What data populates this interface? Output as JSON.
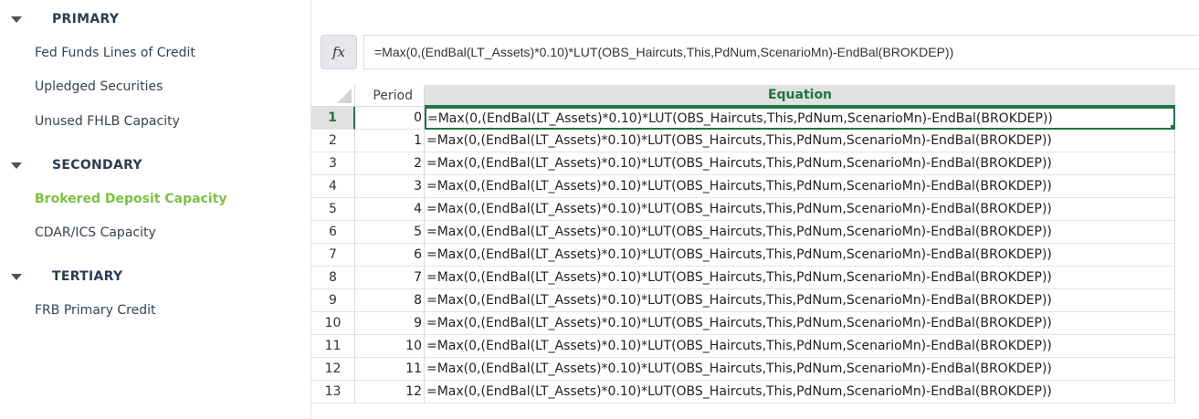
{
  "sidebar": {
    "sections": [
      {
        "title": "PRIMARY",
        "items": [
          "Fed Funds Lines of Credit",
          "Upledged Securities",
          "Unused FHLB Capacity"
        ]
      },
      {
        "title": "SECONDARY",
        "items": [
          "Brokered Deposit Capacity",
          "CDAR/ICS Capacity"
        ]
      },
      {
        "title": "TERTIARY",
        "items": [
          "FRB Primary Credit"
        ]
      }
    ],
    "active_item": "Brokered Deposit Capacity"
  },
  "formula_bar": {
    "fx_label": "fx",
    "value": "=Max(0,(EndBal(LT_Assets)*0.10)*LUT(OBS_Haircuts,This,PdNum,ScenarioMn)-EndBal(BROKDEP))"
  },
  "grid": {
    "headers": {
      "period": "Period",
      "equation": "Equation"
    },
    "rows": [
      {
        "num": "1",
        "period": "0",
        "equation": "=Max(0,(EndBal(LT_Assets)*0.10)*LUT(OBS_Haircuts,This,PdNum,ScenarioMn)-EndBal(BROKDEP))"
      },
      {
        "num": "2",
        "period": "1",
        "equation": "=Max(0,(EndBal(LT_Assets)*0.10)*LUT(OBS_Haircuts,This,PdNum,ScenarioMn)-EndBal(BROKDEP))"
      },
      {
        "num": "3",
        "period": "2",
        "equation": "=Max(0,(EndBal(LT_Assets)*0.10)*LUT(OBS_Haircuts,This,PdNum,ScenarioMn)-EndBal(BROKDEP))"
      },
      {
        "num": "4",
        "period": "3",
        "equation": "=Max(0,(EndBal(LT_Assets)*0.10)*LUT(OBS_Haircuts,This,PdNum,ScenarioMn)-EndBal(BROKDEP))"
      },
      {
        "num": "5",
        "period": "4",
        "equation": "=Max(0,(EndBal(LT_Assets)*0.10)*LUT(OBS_Haircuts,This,PdNum,ScenarioMn)-EndBal(BROKDEP))"
      },
      {
        "num": "6",
        "period": "5",
        "equation": "=Max(0,(EndBal(LT_Assets)*0.10)*LUT(OBS_Haircuts,This,PdNum,ScenarioMn)-EndBal(BROKDEP))"
      },
      {
        "num": "7",
        "period": "6",
        "equation": "=Max(0,(EndBal(LT_Assets)*0.10)*LUT(OBS_Haircuts,This,PdNum,ScenarioMn)-EndBal(BROKDEP))"
      },
      {
        "num": "8",
        "period": "7",
        "equation": "=Max(0,(EndBal(LT_Assets)*0.10)*LUT(OBS_Haircuts,This,PdNum,ScenarioMn)-EndBal(BROKDEP))"
      },
      {
        "num": "9",
        "period": "8",
        "equation": "=Max(0,(EndBal(LT_Assets)*0.10)*LUT(OBS_Haircuts,This,PdNum,ScenarioMn)-EndBal(BROKDEP))"
      },
      {
        "num": "10",
        "period": "9",
        "equation": "=Max(0,(EndBal(LT_Assets)*0.10)*LUT(OBS_Haircuts,This,PdNum,ScenarioMn)-EndBal(BROKDEP))"
      },
      {
        "num": "11",
        "period": "10",
        "equation": "=Max(0,(EndBal(LT_Assets)*0.10)*LUT(OBS_Haircuts,This,PdNum,ScenarioMn)-EndBal(BROKDEP))"
      },
      {
        "num": "12",
        "period": "11",
        "equation": "=Max(0,(EndBal(LT_Assets)*0.10)*LUT(OBS_Haircuts,This,PdNum,ScenarioMn)-EndBal(BROKDEP))"
      },
      {
        "num": "13",
        "period": "12",
        "equation": "=Max(0,(EndBal(LT_Assets)*0.10)*LUT(OBS_Haircuts,This,PdNum,ScenarioMn)-EndBal(BROKDEP))"
      }
    ],
    "selected_row": "1"
  },
  "colors": {
    "accent_green": "#217346",
    "active_nav": "#7cc142",
    "section_title": "#2c3e50"
  }
}
